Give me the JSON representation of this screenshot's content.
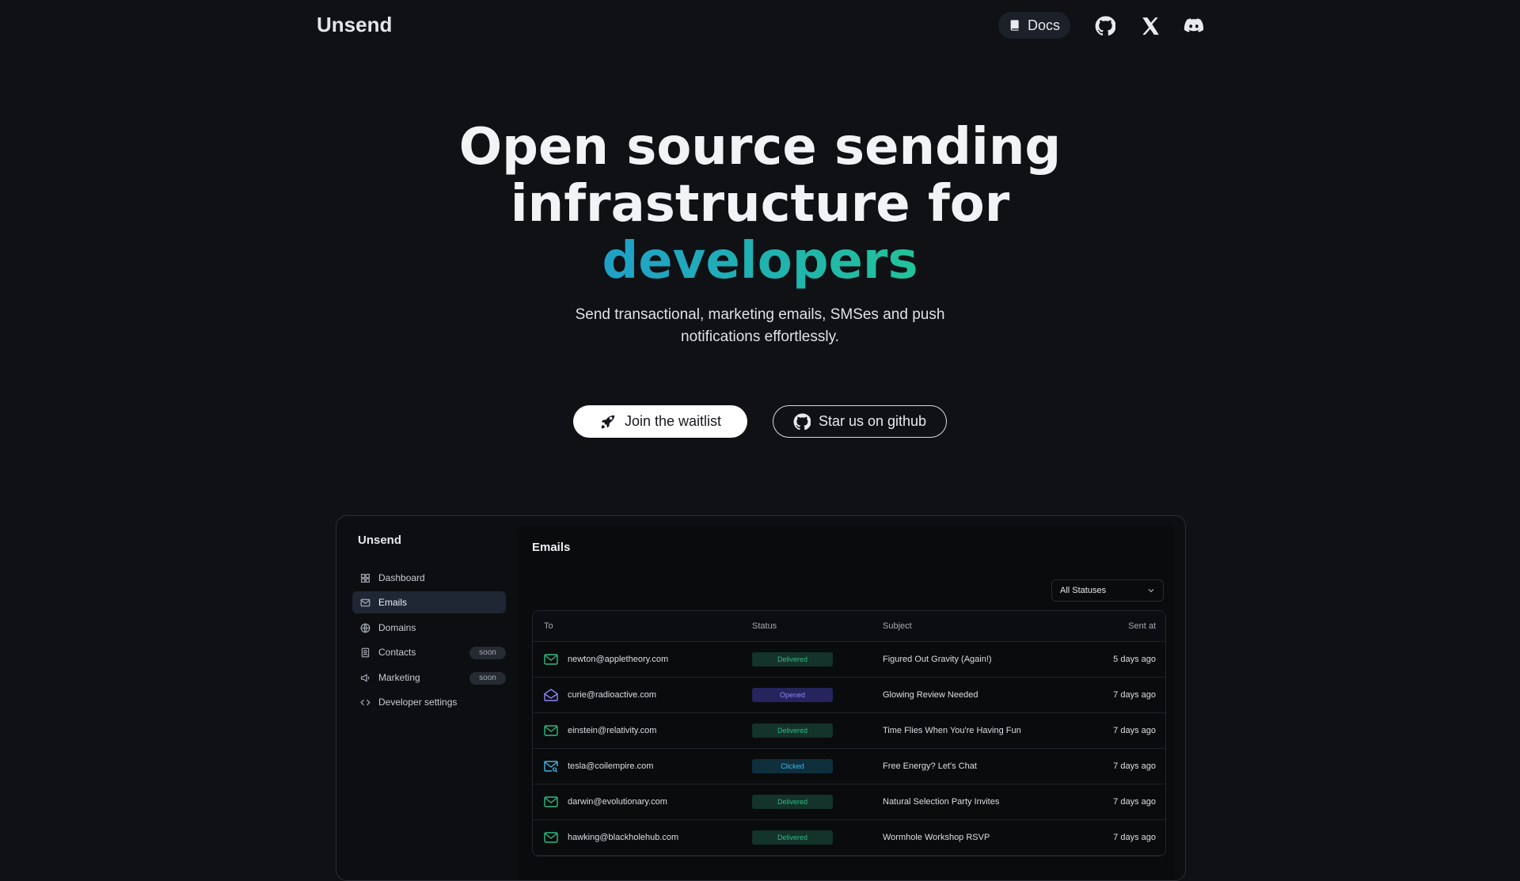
{
  "nav": {
    "brand": "Unsend",
    "docs_label": "Docs",
    "icons": [
      "book-icon",
      "github-icon",
      "x-icon",
      "discord-icon"
    ]
  },
  "hero": {
    "title_line1": "Open source sending",
    "title_line2": "infrastructure for",
    "title_accent": "developers",
    "subtitle": "Send transactional, marketing emails, SMSes and push notifications effortlessly.",
    "primary_cta": "Join the waitlist",
    "secondary_cta": "Star us on github",
    "accent_colors": [
      "#1fa0c8",
      "#22c39a"
    ]
  },
  "app": {
    "brand": "Unsend",
    "sidebar": [
      {
        "label": "Dashboard",
        "icon": "grid-icon",
        "active": false,
        "badge": ""
      },
      {
        "label": "Emails",
        "icon": "mail-icon",
        "active": true,
        "badge": ""
      },
      {
        "label": "Domains",
        "icon": "globe-icon",
        "active": false,
        "badge": ""
      },
      {
        "label": "Contacts",
        "icon": "contact-book-icon",
        "active": false,
        "badge": "soon"
      },
      {
        "label": "Marketing",
        "icon": "megaphone-icon",
        "active": false,
        "badge": "soon"
      },
      {
        "label": "Developer settings",
        "icon": "code-icon",
        "active": false,
        "badge": ""
      }
    ],
    "page_title": "Emails",
    "status_filter": "All Statuses",
    "columns": [
      "To",
      "Status",
      "Subject",
      "Sent at"
    ],
    "rows": [
      {
        "to": "newton@appletheory.com",
        "status": "Delivered",
        "subject": "Figured Out Gravity (Again!)",
        "sent": "5 days ago",
        "icon": "mail-icon"
      },
      {
        "to": "curie@radioactive.com",
        "status": "Opened",
        "subject": "Glowing Review Needed",
        "sent": "7 days ago",
        "icon": "mail-open-icon"
      },
      {
        "to": "einstein@relativity.com",
        "status": "Delivered",
        "subject": "Time Flies When You're Having Fun",
        "sent": "7 days ago",
        "icon": "mail-icon"
      },
      {
        "to": "tesla@coilempire.com",
        "status": "Clicked",
        "subject": "Free Energy? Let's Chat",
        "sent": "7 days ago",
        "icon": "mail-search-icon"
      },
      {
        "to": "darwin@evolutionary.com",
        "status": "Delivered",
        "subject": "Natural Selection Party Invites",
        "sent": "7 days ago",
        "icon": "mail-icon"
      },
      {
        "to": "hawking@blackholehub.com",
        "status": "Delivered",
        "subject": "Wormhole Workshop RSVP",
        "sent": "7 days ago",
        "icon": "mail-icon"
      }
    ],
    "status_colors": {
      "Delivered": "#2dbb83",
      "Opened": "#8d84f7",
      "Clicked": "#3fb6e4"
    }
  }
}
